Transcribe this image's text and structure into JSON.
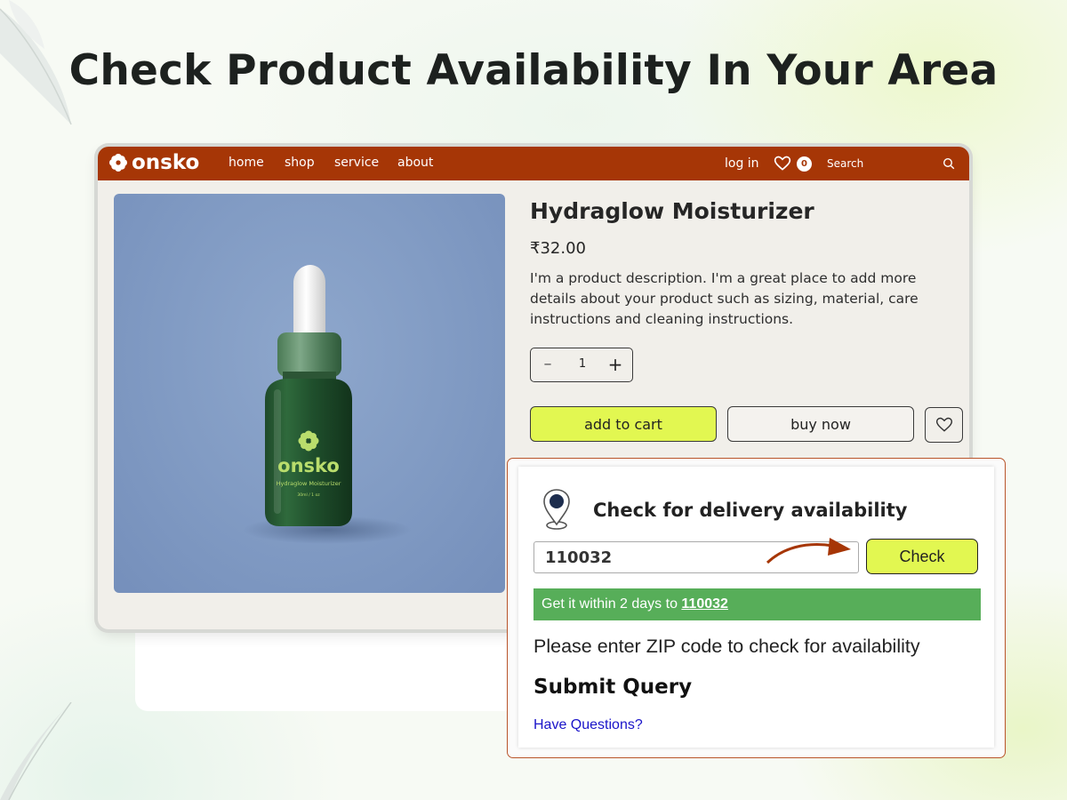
{
  "headline": "Check Product Availability In Your Area",
  "navbar": {
    "brand": "onsko",
    "links": [
      "home",
      "shop",
      "service",
      "about"
    ],
    "login_label": "log in",
    "cart_count": "0",
    "search_label": "Search"
  },
  "product": {
    "title": "Hydraglow Moisturizer",
    "price": "₹32.00",
    "description": "I'm a product description. I'm a great place to add more details about your product such as sizing, material, care instructions and cleaning instructions.",
    "quantity": "1",
    "qty_minus": "–",
    "qty_plus": "+",
    "add_to_cart_label": "add to cart",
    "buy_now_label": "buy now",
    "bottle_brand": "onsko",
    "bottle_product": "Hydraglow Moisturizer",
    "bottle_size": "30ml / 1 oz"
  },
  "delivery": {
    "title": "Check for delivery availability",
    "zip_value": "110032",
    "check_label": "Check",
    "success_prefix": "Get it within 2 days to ",
    "success_zip": "110032",
    "zip_note": "Please enter ZIP code to check for availability",
    "submit_query": "Submit Query",
    "have_questions": "Have Questions?"
  },
  "colors": {
    "navbar": "#a63606",
    "accent_lime": "#e2f751",
    "success_green": "#57ae59",
    "link_blue": "#1a14c9",
    "panel_border": "#b9542a"
  },
  "icons": [
    "onsko-flower-logo-icon",
    "heart-icon",
    "search-icon",
    "location-pin-icon",
    "curved-arrow-icon"
  ]
}
